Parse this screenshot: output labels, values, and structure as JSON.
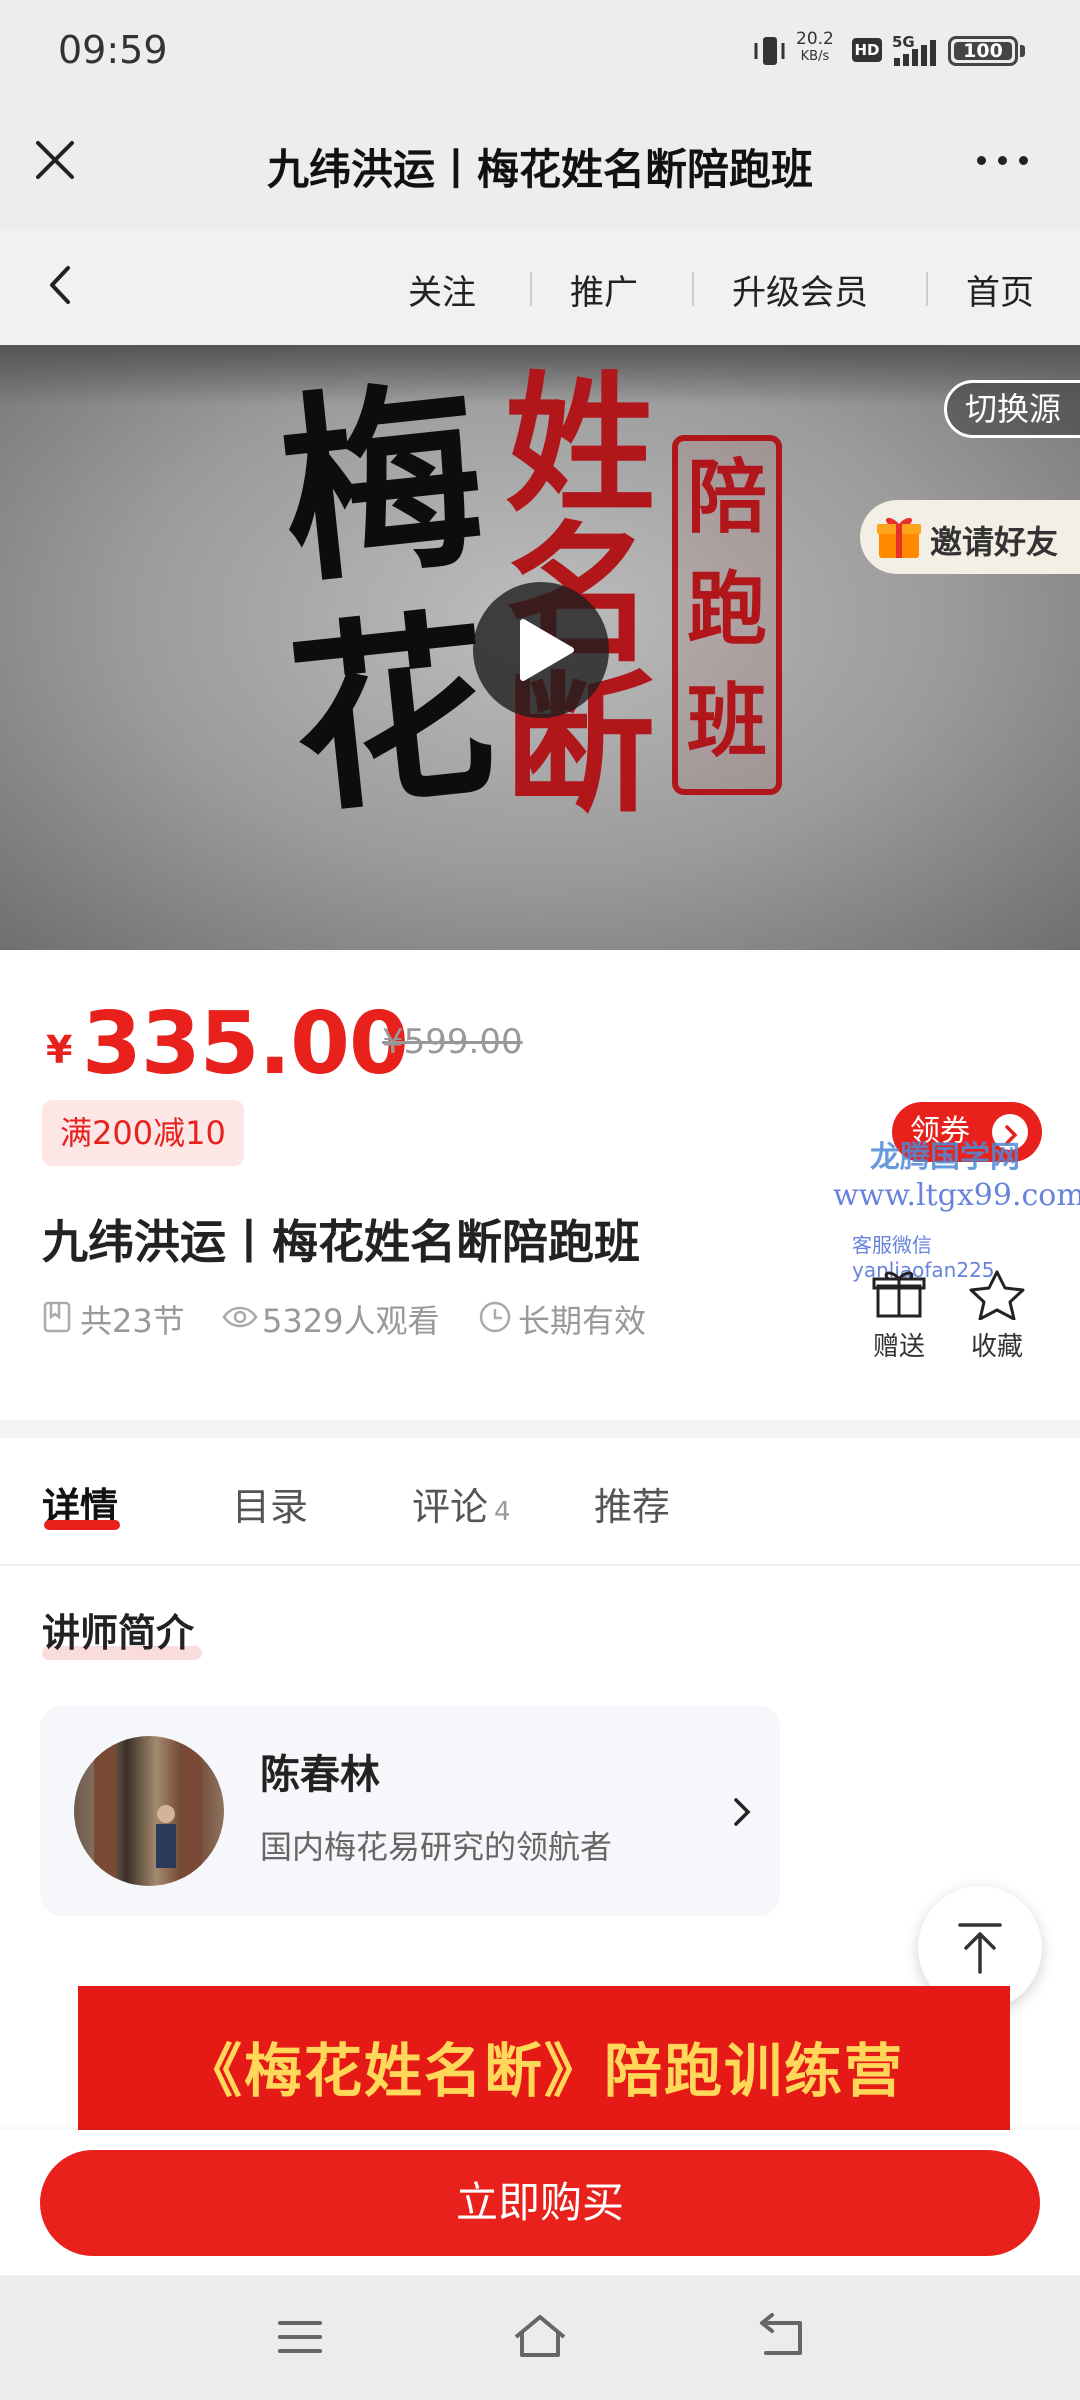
{
  "status_bar": {
    "time": "09:59",
    "net_speed_value": "20.2",
    "net_speed_unit": "KB/s",
    "hd": "HD",
    "network": "5G",
    "battery": "100"
  },
  "title_bar": {
    "title": "九纬洪运丨梅花姓名断陪跑班"
  },
  "nav_bar": {
    "links": [
      "关注",
      "推广",
      "升级会员",
      "首页"
    ]
  },
  "video": {
    "cover_black_chars": [
      "梅",
      "花"
    ],
    "cover_red_chars": [
      "姓",
      "名",
      "断"
    ],
    "seal_chars": [
      "陪",
      "跑",
      "班"
    ],
    "switch_source_label": "切换源",
    "invite_label": "邀请好友"
  },
  "product": {
    "currency": "¥",
    "price": "335.00",
    "original_price": "¥599.00",
    "discount_tag": "满200减10",
    "coupon_label": "领券",
    "title": "九纬洪运丨梅花姓名断陪跑班",
    "lessons": "共23节",
    "views": "5329人观看",
    "validity": "长期有效",
    "gift_label": "赠送",
    "favorite_label": "收藏",
    "watermark": {
      "line1": "龙腾国学网",
      "line2": "www.ltgx99.com",
      "line3": "客服微信 yanliaofan225"
    }
  },
  "tabs": [
    {
      "label": "详情",
      "active": true
    },
    {
      "label": "目录",
      "active": false
    },
    {
      "label": "评论",
      "count": "4",
      "active": false
    },
    {
      "label": "推荐",
      "active": false
    }
  ],
  "content": {
    "section_title": "讲师简介",
    "lecturer": {
      "name": "陈春林",
      "description": "国内梅花易研究的领航者"
    },
    "banner_text": "《梅花姓名断》陪跑训练营"
  },
  "buy_button": "立即购买",
  "colors": {
    "accent": "#e8211d",
    "banner_text": "#ffd85a",
    "watermark": "#4d6ed6"
  },
  "icons": [
    "close-icon",
    "more-icon",
    "back-icon",
    "play-icon",
    "gift-icon",
    "lessons-icon",
    "eye-icon",
    "clock-icon",
    "star-icon",
    "chevron-right-icon",
    "arrow-up-icon",
    "menu-icon",
    "home-icon",
    "return-icon"
  ]
}
